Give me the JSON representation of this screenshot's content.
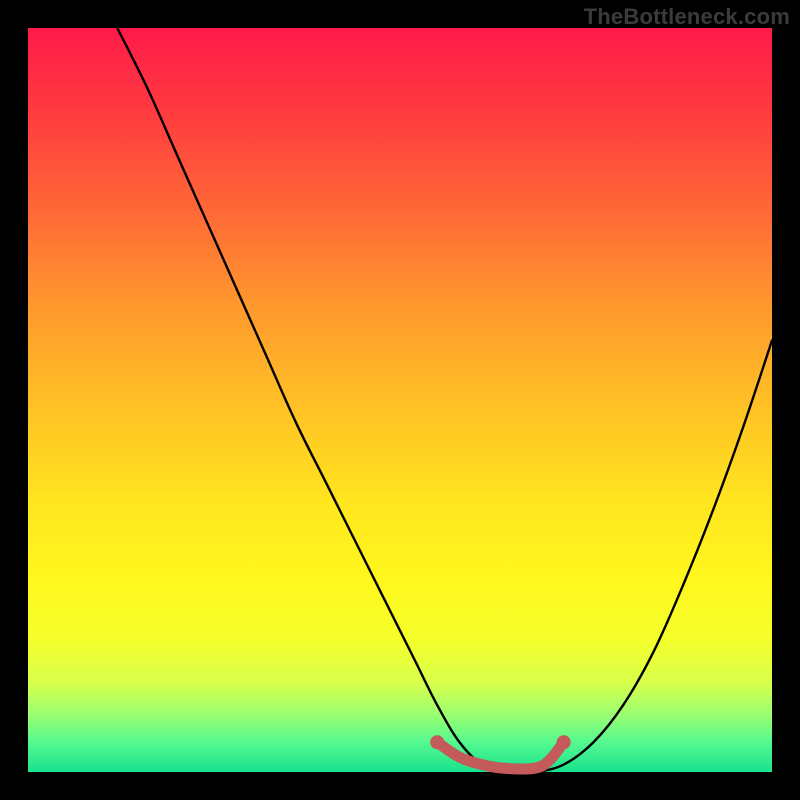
{
  "watermark": "TheBottleneck.com",
  "colors": {
    "background": "#000000",
    "curve_stroke": "#000000",
    "marker_stroke": "#c45a5a",
    "marker_fill": "#c45a5a"
  },
  "chart_data": {
    "type": "line",
    "title": "",
    "xlabel": "",
    "ylabel": "",
    "xlim": [
      0,
      100
    ],
    "ylim": [
      0,
      100
    ],
    "grid": false,
    "series": [
      {
        "name": "bottleneck-curve",
        "x": [
          12,
          16,
          20,
          24,
          28,
          32,
          36,
          40,
          44,
          48,
          52,
          55,
          58,
          61,
          64,
          68,
          72,
          76,
          80,
          84,
          88,
          92,
          96,
          100
        ],
        "y": [
          100,
          92,
          83,
          74,
          65,
          56,
          47,
          39,
          31,
          23,
          15,
          9,
          4,
          1,
          0,
          0,
          1,
          4,
          9,
          16,
          25,
          35,
          46,
          58
        ]
      }
    ],
    "annotations": [
      {
        "name": "highlight-segment",
        "type": "marker-path",
        "x": [
          55,
          58,
          61,
          64,
          68,
          70,
          72
        ],
        "y": [
          4,
          2,
          1,
          0.5,
          0.5,
          1.5,
          4
        ]
      }
    ]
  }
}
